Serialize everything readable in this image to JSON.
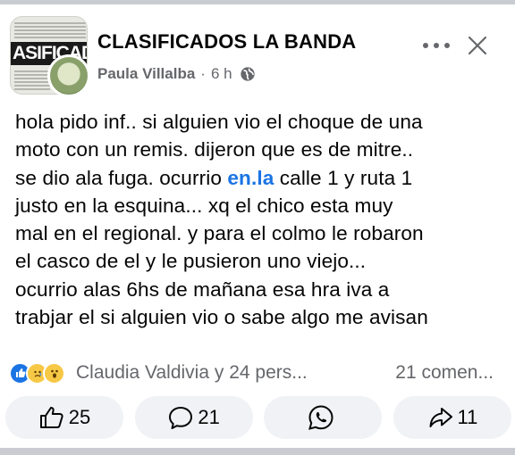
{
  "header": {
    "group_name": "CLASIFICADOS LA BANDA",
    "avatar_text": "ASIFICAD",
    "author": "Paula Villalba",
    "separator": "·",
    "time": "6 h"
  },
  "post": {
    "lines": [
      [
        "hola pido inf.. si alguien vio el choque de una"
      ],
      [
        "moto con un remis. dijeron que es de mitre.."
      ],
      [
        "se dio ala fuga. ocurrio ",
        "en.la",
        " calle 1 y ruta 1"
      ],
      [
        "justo en la esquina... xq el chico esta muy"
      ],
      [
        "mal en el regional. y para el colmo le robaron"
      ],
      [
        "el casco de el y le pusieron uno viejo..."
      ],
      [
        "ocurrio alas 6hs de mañana esa hra iva a"
      ],
      [
        "trabjar el si alguien vio o sabe algo me avisan"
      ]
    ]
  },
  "reactions": {
    "icons": [
      "like-reaction",
      "sad-reaction",
      "wow-reaction"
    ],
    "summary": "Claudia Valdivia y 24 pers...",
    "comments": "21 comen..."
  },
  "actions": {
    "like_count": "25",
    "comment_count": "21",
    "share_count": "11"
  },
  "colors": {
    "link": "#1b74e4",
    "secondary_text": "#65676b",
    "button_bg": "#f0f2f5"
  }
}
